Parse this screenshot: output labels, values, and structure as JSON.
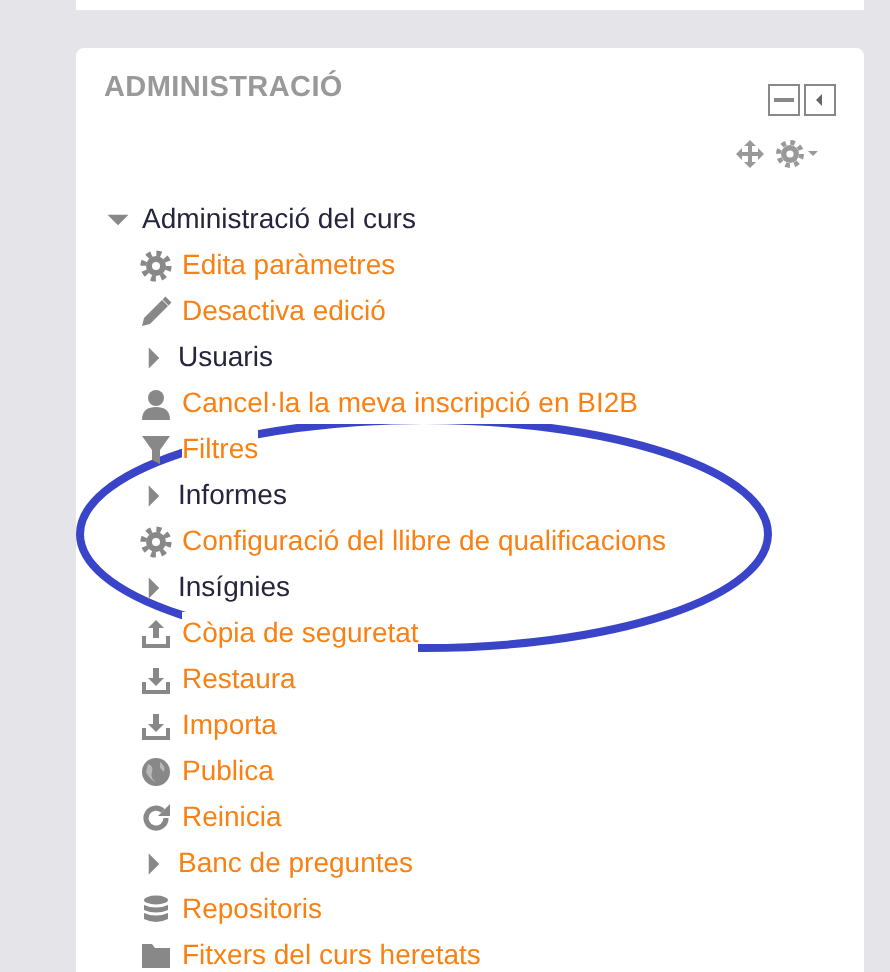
{
  "block": {
    "title": "ADMINISTRACIÓ",
    "tree": {
      "label": "Administració del curs",
      "expanded": true,
      "children": [
        {
          "kind": "link",
          "label": "Edita paràmetres"
        },
        {
          "kind": "link",
          "label": "Desactiva edició"
        },
        {
          "kind": "branch",
          "label": "Usuaris",
          "expanded": false
        },
        {
          "kind": "link",
          "label": "Cancel·la la meva inscripció en BI2B"
        },
        {
          "kind": "link",
          "label": "Filtres"
        },
        {
          "kind": "branch",
          "label": "Informes",
          "expanded": false
        },
        {
          "kind": "link",
          "label": "Configuració del llibre de qualificacions"
        },
        {
          "kind": "branch",
          "label": "Insígnies",
          "expanded": false
        },
        {
          "kind": "link",
          "label": "Còpia de seguretat"
        },
        {
          "kind": "link",
          "label": "Restaura"
        },
        {
          "kind": "link",
          "label": "Importa"
        },
        {
          "kind": "link",
          "label": "Publica"
        },
        {
          "kind": "link",
          "label": "Reinicia"
        },
        {
          "kind": "branch-link",
          "label": "Banc de preguntes",
          "expanded": false
        },
        {
          "kind": "link",
          "label": "Repositoris"
        },
        {
          "kind": "link",
          "label": "Fitxers del curs heretats"
        }
      ]
    }
  },
  "annotation": {
    "kind": "ellipse",
    "color": "#3a44c8"
  }
}
